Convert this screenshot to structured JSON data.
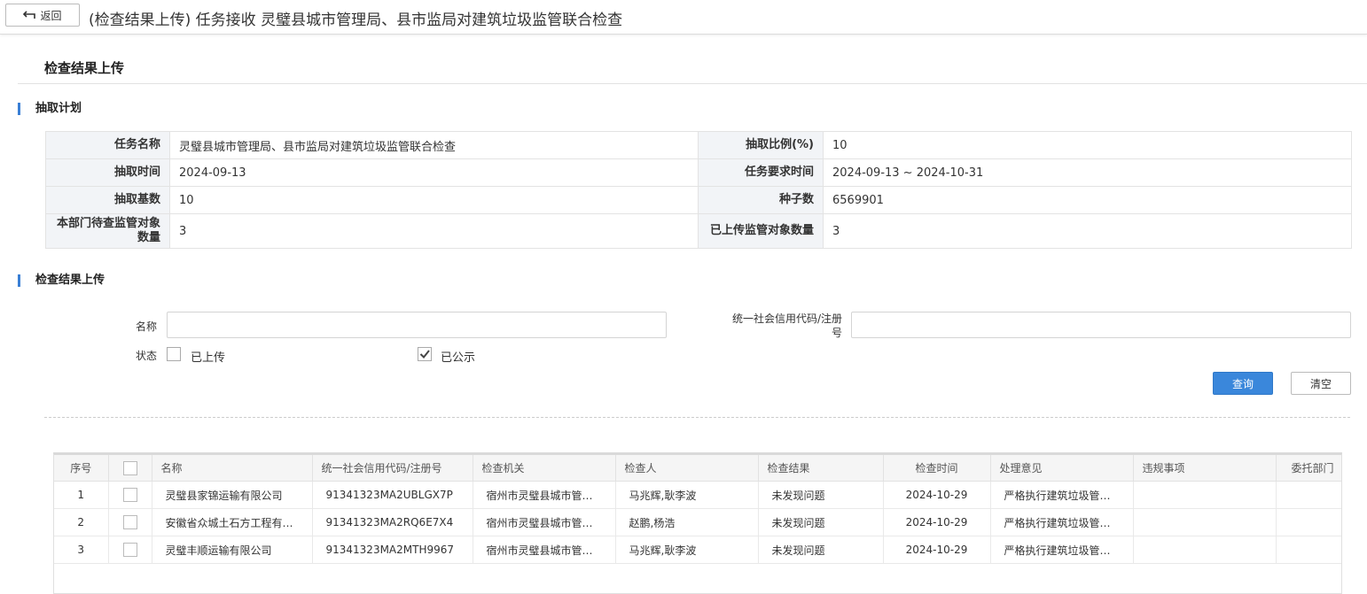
{
  "header": {
    "back_label": "返回",
    "title": "(检查结果上传) 任务接收 灵璧县城市管理局、县市监局对建筑垃圾监管联合检查"
  },
  "section_title": "检查结果上传",
  "plan": {
    "heading": "抽取计划",
    "rows": [
      [
        {
          "label": "任务名称",
          "value": "灵璧县城市管理局、县市监局对建筑垃圾监管联合检查"
        },
        {
          "label": "抽取比例(%)",
          "value": "10"
        }
      ],
      [
        {
          "label": "抽取时间",
          "value": "2024-09-13"
        },
        {
          "label": "任务要求时间",
          "value": "2024-09-13 ~ 2024-10-31"
        }
      ],
      [
        {
          "label": "抽取基数",
          "value": "10"
        },
        {
          "label": "种子数",
          "value": "6569901"
        }
      ],
      [
        {
          "label": "本部门待查监管对象数量",
          "value": "3"
        },
        {
          "label": "已上传监管对象数量",
          "value": "3"
        }
      ]
    ]
  },
  "upload": {
    "heading": "检查结果上传",
    "name_label": "名称",
    "name_value": "",
    "credit_label": "统一社会信用代码/注册号",
    "credit_value": "",
    "status_label": "状态",
    "status_options": [
      {
        "label": "已上传",
        "checked": false
      },
      {
        "label": "已公示",
        "checked": true
      }
    ],
    "query_label": "查询",
    "clear_label": "清空"
  },
  "grid": {
    "columns": [
      "序号",
      "",
      "名称",
      "统一社会信用代码/注册号",
      "检查机关",
      "检查人",
      "检查结果",
      "检查时间",
      "处理意见",
      "违规事项",
      "委托部门"
    ],
    "rows": [
      [
        "1",
        "",
        "灵璧县家锦运输有限公司",
        "91341323MA2UBLGX7P",
        "宿州市灵璧县城市管理局",
        "马兆辉,耿李波",
        "未发现问题",
        "2024-10-29",
        "严格执行建筑垃圾管理规定",
        "",
        ""
      ],
      [
        "2",
        "",
        "安徽省众城土石方工程有限公司",
        "91341323MA2RQ6E7X4",
        "宿州市灵璧县城市管理局",
        "赵鹏,杨浩",
        "未发现问题",
        "2024-10-29",
        "严格执行建筑垃圾管理规定",
        "",
        ""
      ],
      [
        "3",
        "",
        "灵璧丰顺运输有限公司",
        "91341323MA2MTH9967",
        "宿州市灵璧县城市管理局",
        "马兆辉,耿李波",
        "未发现问题",
        "2024-10-29",
        "严格执行建筑垃圾管理规定",
        "",
        ""
      ]
    ]
  },
  "icons": {
    "back": "return-arrow-icon",
    "checkmark": "checkmark-icon"
  },
  "colors": {
    "accent": "#3a87db",
    "section_bar": "#3a7fd5",
    "label_bg": "#f2f4f7"
  }
}
